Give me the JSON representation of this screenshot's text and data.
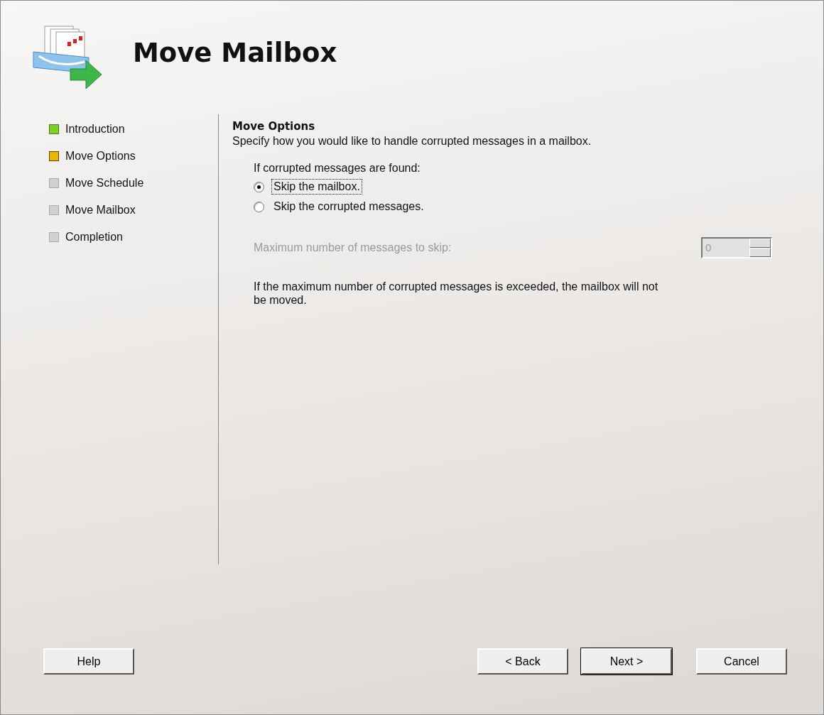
{
  "window": {
    "title": "Move Mailbox"
  },
  "steps": [
    {
      "label": "Introduction",
      "completed": true,
      "current": false
    },
    {
      "label": "Move Options",
      "completed": false,
      "current": true
    },
    {
      "label": "Move Schedule",
      "completed": false,
      "current": false
    },
    {
      "label": "Move Mailbox",
      "completed": false,
      "current": false
    },
    {
      "label": "Completion",
      "completed": false,
      "current": false
    }
  ],
  "page": {
    "heading": "Move Options",
    "description": "Specify how you would like to handle corrupted messages in a mailbox.",
    "prompt": "If corrupted messages are found:",
    "options": [
      {
        "label": "Skip the mailbox.",
        "selected": true,
        "focused": true
      },
      {
        "label": "Skip the corrupted messages.",
        "selected": false,
        "focused": false
      }
    ],
    "max_skip": {
      "label": "Maximum number of messages to skip:",
      "value": "0",
      "disabled": true
    },
    "note": "If the maximum number of corrupted messages is exceeded, the mailbox will not be moved."
  },
  "buttons": [
    {
      "label": "Help",
      "default": false
    },
    {
      "label": "< Back",
      "default": false
    },
    {
      "label": "Next >",
      "default": true
    },
    {
      "label": "Cancel",
      "default": false
    }
  ]
}
